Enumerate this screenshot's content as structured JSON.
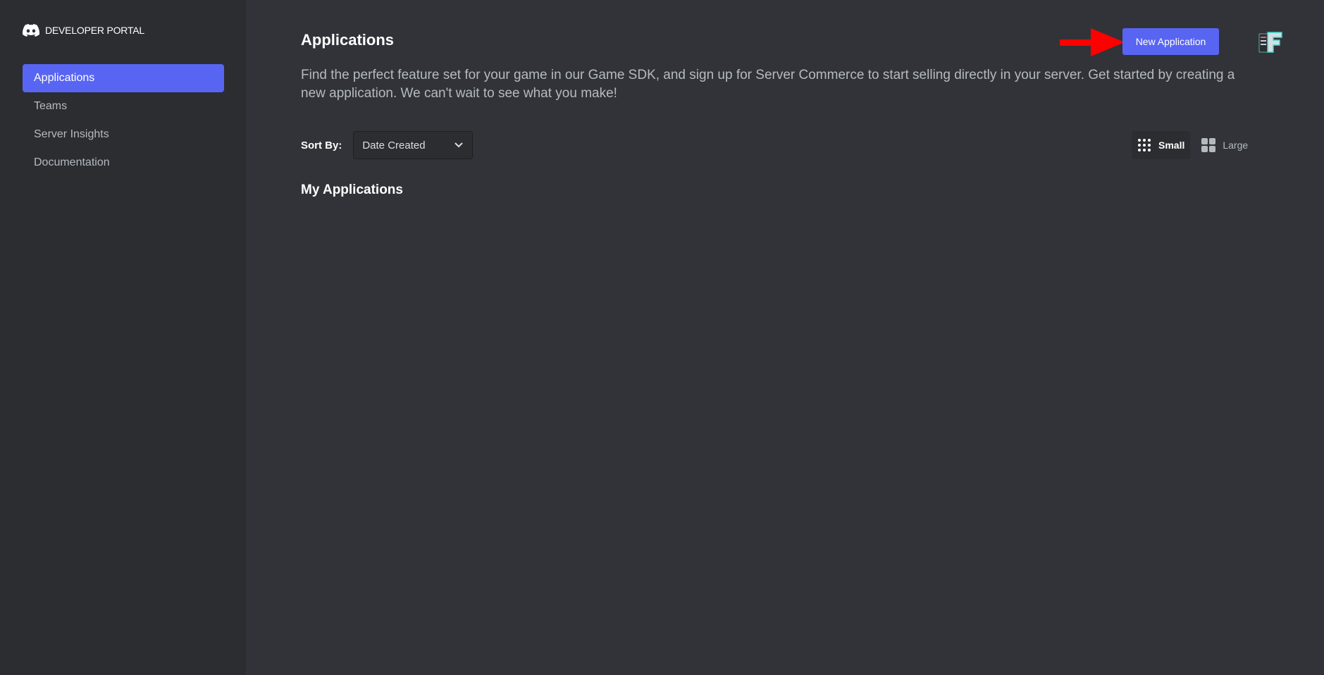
{
  "brand": {
    "label": "DEVELOPER PORTAL",
    "icon": "discord-logo-icon"
  },
  "sidebar": {
    "items": [
      {
        "label": "Applications",
        "active": true
      },
      {
        "label": "Teams",
        "active": false
      },
      {
        "label": "Server Insights",
        "active": false
      },
      {
        "label": "Documentation",
        "active": false
      }
    ]
  },
  "header": {
    "title": "Applications",
    "description": "Find the perfect feature set for your game in our Game SDK, and sign up for Server Commerce to start selling directly in your server. Get started by creating a new application. We can't wait to see what you make!",
    "new_app_label": "New Application"
  },
  "colors": {
    "accent": "#5865f2",
    "annotation_arrow": "#ff0000"
  },
  "sort": {
    "label": "Sort By:",
    "value": "Date Created"
  },
  "view": {
    "small_label": "Small",
    "large_label": "Large",
    "selected": "Small"
  },
  "section": {
    "title": "My Applications"
  }
}
